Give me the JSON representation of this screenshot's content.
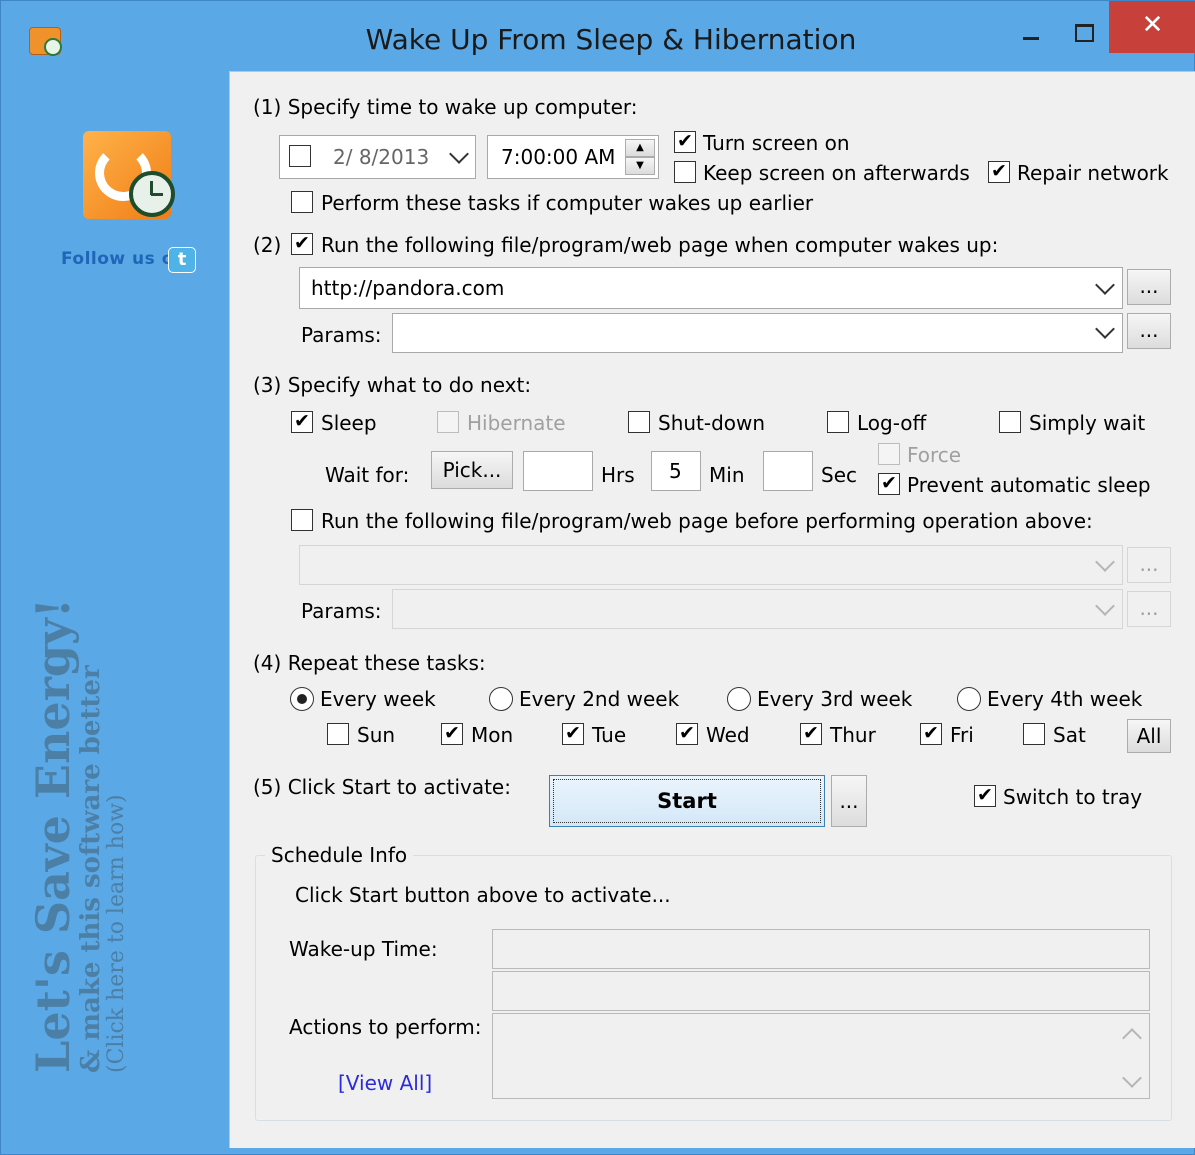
{
  "window": {
    "title": "Wake Up From Sleep & Hibernation",
    "close_glyph": "✕"
  },
  "side": {
    "follow_us": "Follow us on",
    "twitter_glyph": "t",
    "promo_line1": "Let's Save Energy!",
    "promo_line2": "& make this software better",
    "promo_line3": "(Click here to learn how)"
  },
  "section1": {
    "heading": "(1) Specify time to wake up computer:",
    "date_value": "2/  8/2013",
    "time_value": "7:00:00 AM",
    "turn_screen_on": {
      "label": "Turn screen on",
      "checked": true
    },
    "keep_screen_on": {
      "label": "Keep screen on afterwards",
      "checked": false
    },
    "repair_network": {
      "label": "Repair network",
      "checked": true
    },
    "perform_if_earlier": {
      "label": "Perform these tasks if computer wakes up earlier",
      "checked": false
    }
  },
  "section2": {
    "heading_prefix": "(2)",
    "run_label": "Run the following file/program/web page when computer wakes up:",
    "run_checked": true,
    "url_value": "http://pandora.com",
    "params_label": "Params:",
    "params_value": "",
    "browse_label": "..."
  },
  "section3": {
    "heading": "(3) Specify what to do next:",
    "options": {
      "sleep": {
        "label": "Sleep",
        "checked": true
      },
      "hibernate": {
        "label": "Hibernate",
        "checked": false,
        "disabled": true
      },
      "shutdown": {
        "label": "Shut-down",
        "checked": false
      },
      "logoff": {
        "label": "Log-off",
        "checked": false
      },
      "simply_wait": {
        "label": "Simply wait",
        "checked": false
      }
    },
    "wait_for_label": "Wait for:",
    "pick_label": "Pick...",
    "hrs_value": "",
    "hrs_label": "Hrs",
    "min_value": "5",
    "min_label": "Min",
    "sec_value": "",
    "sec_label": "Sec",
    "force": {
      "label": "Force",
      "checked": false,
      "disabled": true
    },
    "prevent_sleep": {
      "label": "Prevent automatic sleep",
      "checked": true
    },
    "run_before": {
      "label": "Run the following file/program/web page before performing operation above:",
      "checked": false
    },
    "params_label": "Params:",
    "browse_label": "..."
  },
  "section4": {
    "heading": "(4) Repeat these tasks:",
    "frequency": [
      {
        "label": "Every week",
        "selected": true
      },
      {
        "label": "Every 2nd week",
        "selected": false
      },
      {
        "label": "Every 3rd week",
        "selected": false
      },
      {
        "label": "Every 4th week",
        "selected": false
      }
    ],
    "days": [
      {
        "label": "Sun",
        "checked": false
      },
      {
        "label": "Mon",
        "checked": true
      },
      {
        "label": "Tue",
        "checked": true
      },
      {
        "label": "Wed",
        "checked": true
      },
      {
        "label": "Thur",
        "checked": true
      },
      {
        "label": "Fri",
        "checked": true
      },
      {
        "label": "Sat",
        "checked": false
      }
    ],
    "all_label": "All"
  },
  "section5": {
    "heading": "(5) Click Start to activate:",
    "start_label": "Start",
    "more_label": "...",
    "switch_to_tray": {
      "label": "Switch to tray",
      "checked": true
    }
  },
  "schedule": {
    "title": "Schedule Info",
    "message": "Click Start button above to activate...",
    "wake_label": "Wake-up Time:",
    "actions_label": "Actions to perform:",
    "view_all": "[View All]"
  },
  "glyphs": {
    "check": "✔",
    "up": "▲",
    "down": "▼"
  }
}
